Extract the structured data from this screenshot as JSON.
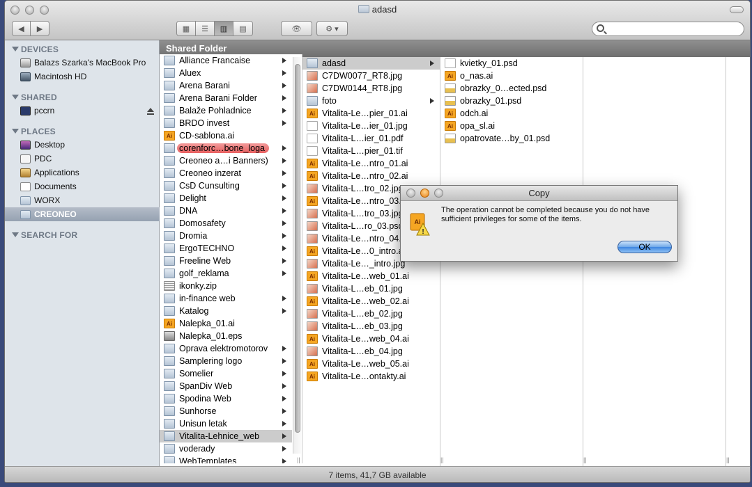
{
  "window": {
    "title": "adasd"
  },
  "toolbar": {
    "back_icon": "back-arrow-icon",
    "forward_icon": "forward-arrow-icon",
    "views": [
      "icon-view",
      "list-view",
      "column-view",
      "coverflow-view"
    ],
    "active_view": "column-view",
    "quicklook_icon": "eye-icon",
    "action_icon": "gear-icon",
    "search": {
      "placeholder": "",
      "value": ""
    }
  },
  "sidebar": {
    "devices_header": "DEVICES",
    "devices": [
      {
        "label": "Balazs Szarka's MacBook Pro",
        "icon": "laptop-icon"
      },
      {
        "label": "Macintosh HD",
        "icon": "harddrive-icon"
      }
    ],
    "shared_header": "SHARED",
    "shared": [
      {
        "label": "pccrn",
        "icon": "computer-icon"
      }
    ],
    "places_header": "PLACES",
    "places": [
      {
        "label": "Desktop",
        "icon": "desktop-icon"
      },
      {
        "label": "PDC",
        "icon": "home-icon"
      },
      {
        "label": "Applications",
        "icon": "applications-icon"
      },
      {
        "label": "Documents",
        "icon": "documents-icon"
      },
      {
        "label": "WORX",
        "icon": "folder-icon"
      },
      {
        "label": "CREONEO",
        "icon": "folder-icon",
        "selected": true
      }
    ],
    "search_header": "SEARCH FOR"
  },
  "path_bar": {
    "label": "Shared Folder"
  },
  "column1": [
    {
      "label": "Alliance Francaise",
      "type": "folder",
      "arrow": true
    },
    {
      "label": "Aluex",
      "type": "folder",
      "arrow": true
    },
    {
      "label": "Arena Barani",
      "type": "folder",
      "arrow": true
    },
    {
      "label": "Arena Barani Folder",
      "type": "folder",
      "arrow": true
    },
    {
      "label": "Balaže Pohladnice",
      "type": "folder",
      "arrow": true
    },
    {
      "label": "BRDO invest",
      "type": "folder",
      "arrow": true
    },
    {
      "label": "CD-sablona.ai",
      "type": "ai",
      "arrow": false
    },
    {
      "label": "corenforc…bone_loga",
      "type": "folder",
      "arrow": true,
      "selected_label": true
    },
    {
      "label": "Creoneo a…i Banners)",
      "type": "folder",
      "arrow": true
    },
    {
      "label": "Creoneo inzerat",
      "type": "folder",
      "arrow": true
    },
    {
      "label": "CsD Cunsulting",
      "type": "folder",
      "arrow": true
    },
    {
      "label": "Delight",
      "type": "folder",
      "arrow": true
    },
    {
      "label": "DNA",
      "type": "folder",
      "arrow": true
    },
    {
      "label": "Domosafety",
      "type": "folder",
      "arrow": true
    },
    {
      "label": "Dromia",
      "type": "folder",
      "arrow": true
    },
    {
      "label": "ErgoTECHNO",
      "type": "folder",
      "arrow": true
    },
    {
      "label": "Freeline Web",
      "type": "folder",
      "arrow": true
    },
    {
      "label": "golf_reklama",
      "type": "folder",
      "arrow": true
    },
    {
      "label": "ikonky.zip",
      "type": "zip",
      "arrow": false
    },
    {
      "label": "in-finance web",
      "type": "folder",
      "arrow": true
    },
    {
      "label": "Katalog",
      "type": "folder",
      "arrow": true
    },
    {
      "label": "Nalepka_01.ai",
      "type": "ai",
      "arrow": false
    },
    {
      "label": "Nalepka_01.eps",
      "type": "eps",
      "arrow": false
    },
    {
      "label": "Oprava elektromotorov",
      "type": "folder",
      "arrow": true
    },
    {
      "label": "Samplering logo",
      "type": "folder",
      "arrow": true
    },
    {
      "label": "Somelier",
      "type": "folder",
      "arrow": true
    },
    {
      "label": "SpanDiv Web",
      "type": "folder",
      "arrow": true
    },
    {
      "label": "Spodina Web",
      "type": "folder",
      "arrow": true
    },
    {
      "label": "Sunhorse",
      "type": "folder",
      "arrow": true
    },
    {
      "label": "Unisun letak",
      "type": "folder",
      "arrow": true
    },
    {
      "label": "Vitalita-Lehnice_web",
      "type": "folder",
      "arrow": true,
      "selected": true
    },
    {
      "label": "voderady",
      "type": "folder",
      "arrow": true
    },
    {
      "label": "WebTemplates",
      "type": "folder",
      "arrow": true
    }
  ],
  "column2": [
    {
      "label": "adasd",
      "type": "folder",
      "arrow": true,
      "selected": true
    },
    {
      "label": "C7DW0077_RT8.jpg",
      "type": "img",
      "arrow": false
    },
    {
      "label": "C7DW0144_RT8.jpg",
      "type": "img",
      "arrow": false
    },
    {
      "label": "foto",
      "type": "folder",
      "arrow": true
    },
    {
      "label": "Vitalita-Le…pier_01.ai",
      "type": "ai",
      "arrow": false
    },
    {
      "label": "Vitalita-Le…ier_01.jpg",
      "type": "doc",
      "arrow": false
    },
    {
      "label": "Vitalita-L…ier_01.pdf",
      "type": "doc",
      "arrow": false
    },
    {
      "label": "Vitalita-L…pier_01.tif",
      "type": "doc",
      "arrow": false
    },
    {
      "label": "Vitalita-Le…ntro_01.ai",
      "type": "ai",
      "arrow": false
    },
    {
      "label": "Vitalita-Le…ntro_02.ai",
      "type": "ai",
      "arrow": false
    },
    {
      "label": "Vitalita-L…tro_02.jpg",
      "type": "img",
      "arrow": false
    },
    {
      "label": "Vitalita-Le…ntro_03.ai",
      "type": "ai",
      "arrow": false
    },
    {
      "label": "Vitalita-L…tro_03.jpg",
      "type": "img",
      "arrow": false
    },
    {
      "label": "Vitalita-L…ro_03.psd",
      "type": "img",
      "arrow": false
    },
    {
      "label": "Vitalita-Le…ntro_04.ai",
      "type": "img",
      "arrow": false
    },
    {
      "label": "Vitalita-Le…0_intro.ai",
      "type": "ai",
      "arrow": false
    },
    {
      "label": "Vitalita-Le…_intro.jpg",
      "type": "img",
      "arrow": false
    },
    {
      "label": "Vitalita-Le…web_01.ai",
      "type": "ai",
      "arrow": false
    },
    {
      "label": "Vitalita-L…eb_01.jpg",
      "type": "img",
      "arrow": false
    },
    {
      "label": "Vitalita-Le…web_02.ai",
      "type": "ai",
      "arrow": false
    },
    {
      "label": "Vitalita-L…eb_02.jpg",
      "type": "img",
      "arrow": false
    },
    {
      "label": "Vitalita-L…eb_03.jpg",
      "type": "img",
      "arrow": false
    },
    {
      "label": "Vitalita-Le…web_04.ai",
      "type": "ai",
      "arrow": false
    },
    {
      "label": "Vitalita-L…eb_04.jpg",
      "type": "img",
      "arrow": false
    },
    {
      "label": "Vitalita-Le…web_05.ai",
      "type": "ai",
      "arrow": false
    },
    {
      "label": "Vitalita-Le…ontakty.ai",
      "type": "ai",
      "arrow": false
    }
  ],
  "column3": [
    {
      "label": "kvietky_01.psd",
      "type": "doc"
    },
    {
      "label": "o_nas.ai",
      "type": "ai"
    },
    {
      "label": "obrazky_0…ected.psd",
      "type": "psd"
    },
    {
      "label": "obrazky_01.psd",
      "type": "psd"
    },
    {
      "label": "odch.ai",
      "type": "ai"
    },
    {
      "label": "opa_sl.ai",
      "type": "ai"
    },
    {
      "label": "opatrovate…by_01.psd",
      "type": "psd"
    }
  ],
  "status_bar": {
    "text": "7 items, 41,7 GB available"
  },
  "dialog": {
    "title": "Copy",
    "message": "The operation cannot be completed because you do not have sufficient privileges for some of the items.",
    "icon": "warning-ai-icon",
    "ok_label": "OK"
  },
  "colors": {
    "sidebar_bg": "#dee4ea",
    "selection_red": "#e65c5c",
    "ok_blue": "#3f86e0"
  }
}
